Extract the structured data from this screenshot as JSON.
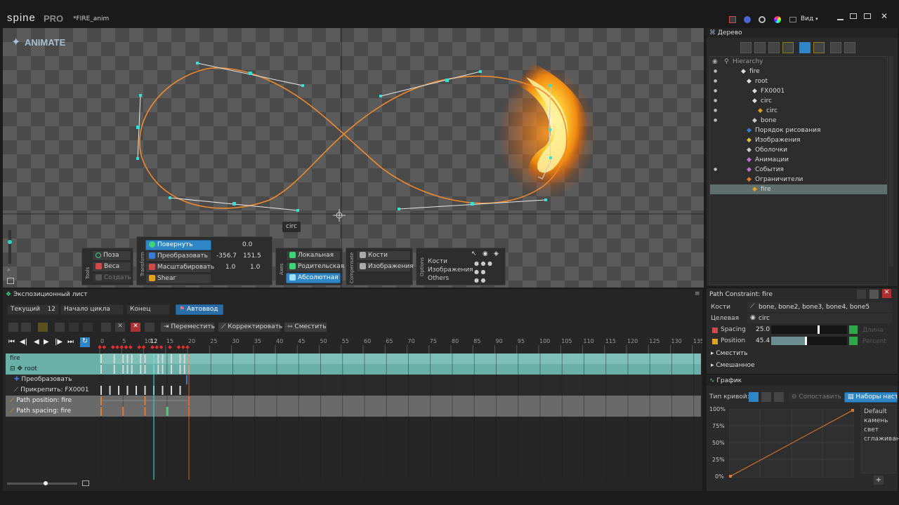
{
  "app": {
    "logo": "spine",
    "edition": "PRO",
    "file_title": "*FIRE_anim",
    "view_menu": "Вид"
  },
  "viewport": {
    "mode_label": "ANIMATE",
    "selected_label": "circ"
  },
  "toolbar": {
    "tools_title": "Tools",
    "pose": "Поза",
    "weights": "Веса",
    "create": "Создать",
    "transform_title": "Transform",
    "rotate": {
      "label": "Повернуть",
      "value": "0.0"
    },
    "translate": {
      "label": "Преобразовать",
      "x": "-356.7",
      "y": "151.5"
    },
    "scale": {
      "label": "Масштабировать",
      "x": "1.0",
      "y": "1.0"
    },
    "shear": {
      "label": "Shear"
    },
    "axes_title": "Axes",
    "local": "Локальная",
    "parent": "Родительская",
    "absolute": "Абсолютная",
    "compensate_title": "Compensate",
    "bones": "Кости",
    "images": "Изображения",
    "options_title": "Options",
    "opt_bones": "Кости",
    "opt_images": "Изображения",
    "opt_others": "Others"
  },
  "tree": {
    "title": "Дерево",
    "hierarchy_label": "Hierarchy",
    "items": [
      {
        "label": "fire",
        "indent": 1
      },
      {
        "label": "root",
        "indent": 2
      },
      {
        "label": "FX0001",
        "indent": 3
      },
      {
        "label": "circ",
        "indent": 3
      },
      {
        "label": "circ",
        "indent": 4
      },
      {
        "label": "bone",
        "indent": 3
      },
      {
        "label": "Порядок рисования",
        "indent": 2
      },
      {
        "label": "Изображения",
        "indent": 2
      },
      {
        "label": "Оболочки",
        "indent": 2
      },
      {
        "label": "Анимации",
        "indent": 2
      },
      {
        "label": "События",
        "indent": 2
      },
      {
        "label": "Ограничители",
        "indent": 2
      },
      {
        "label": "fire",
        "indent": 3
      }
    ]
  },
  "constraint": {
    "title": "Path Constraint: fire",
    "bones_label": "Кости",
    "bones_value": "bone, bone2, bone3, bone4, bone5",
    "target_label": "Целевая",
    "target_value": "circ",
    "spacing_label": "Spacing",
    "spacing_value": "25.0",
    "spacing_mode": "Длина",
    "position_label": "Position",
    "position_value": "45.4",
    "position_mode": "Percent",
    "offset_label": "Сместить",
    "mix_label": "Смешанное"
  },
  "graph": {
    "title": "График",
    "curve_type_label": "Тип кривой:",
    "match_button": "Сопоставить",
    "presets_button": "Наборы настр",
    "y_ticks": [
      "100%",
      "75%",
      "50%",
      "25%",
      "0%"
    ],
    "presets": [
      "Default",
      "камень",
      "свет",
      "сглаживан"
    ]
  },
  "dopesheet": {
    "title": "Экспозиционный лист",
    "current_label": "Текущий",
    "current_frame": "12",
    "loop_start_label": "Начало цикла",
    "end_label": "Конец",
    "autokey_label": "Автоввод",
    "move_button": "Переместить",
    "adjust_button": "Корректировать",
    "offset_button": "Сместить",
    "ruler_ticks": [
      "0",
      "5",
      "10",
      "15",
      "20",
      "25",
      "30",
      "35",
      "40",
      "45",
      "50",
      "55",
      "60",
      "65",
      "70",
      "75",
      "80",
      "85",
      "90",
      "95",
      "100",
      "105",
      "110",
      "115",
      "120",
      "125",
      "130",
      "135"
    ],
    "tracks": [
      "fire",
      "root",
      "Преобразовать",
      "Прикрепить: FX0001",
      "Path position: fire",
      "Path spacing: fire"
    ]
  }
}
